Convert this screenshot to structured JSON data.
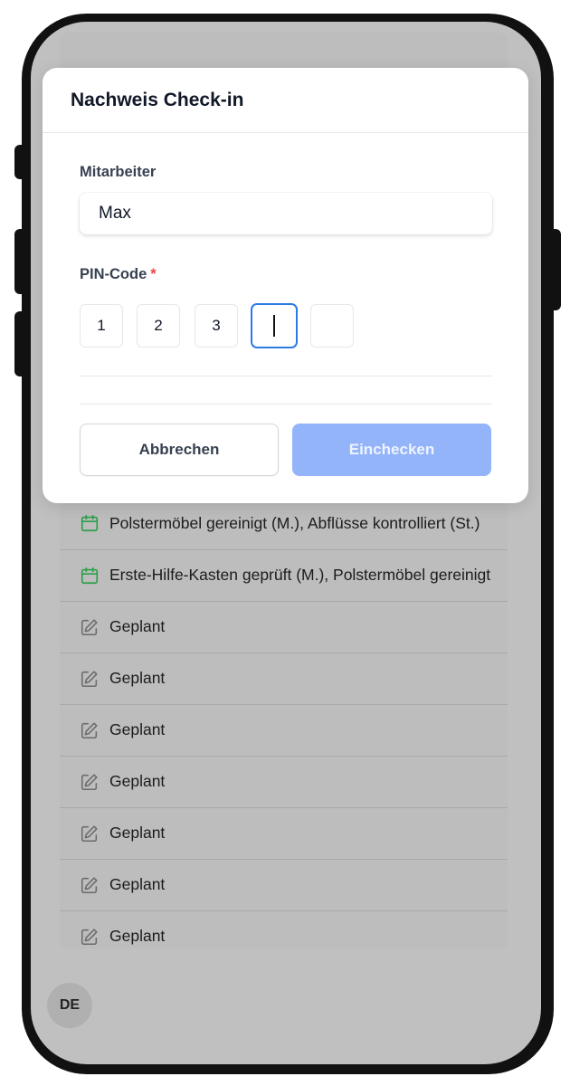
{
  "modal": {
    "title": "Nachweis Check-in",
    "employee_label": "Mitarbeiter",
    "employee_value": "Max",
    "pin_label": "PIN-Code",
    "pin_required_mark": "*",
    "pin_digits": [
      "1",
      "2",
      "3",
      "",
      ""
    ],
    "cancel_label": "Abbrechen",
    "checkin_label": "Einchecken"
  },
  "list": {
    "rows": [
      {
        "icon": "calendar-icon",
        "text": "Polstermöbel gereinigt (M.), Abflüsse kontrolliert (St.)"
      },
      {
        "icon": "calendar-icon",
        "text": "Erste-Hilfe-Kasten geprüft (M.), Polstermöbel gereinigt"
      },
      {
        "icon": "edit-icon",
        "text": "Geplant"
      },
      {
        "icon": "edit-icon",
        "text": "Geplant"
      },
      {
        "icon": "edit-icon",
        "text": "Geplant"
      },
      {
        "icon": "edit-icon",
        "text": "Geplant"
      },
      {
        "icon": "edit-icon",
        "text": "Geplant"
      },
      {
        "icon": "edit-icon",
        "text": "Geplant"
      },
      {
        "icon": "edit-icon",
        "text": "Geplant"
      }
    ]
  },
  "language": "DE",
  "colors": {
    "primary_disabled": "#93b4f9",
    "focus_ring": "#2b7be6",
    "required": "#ef4444",
    "calendar_icon": "#2e9e4a"
  }
}
